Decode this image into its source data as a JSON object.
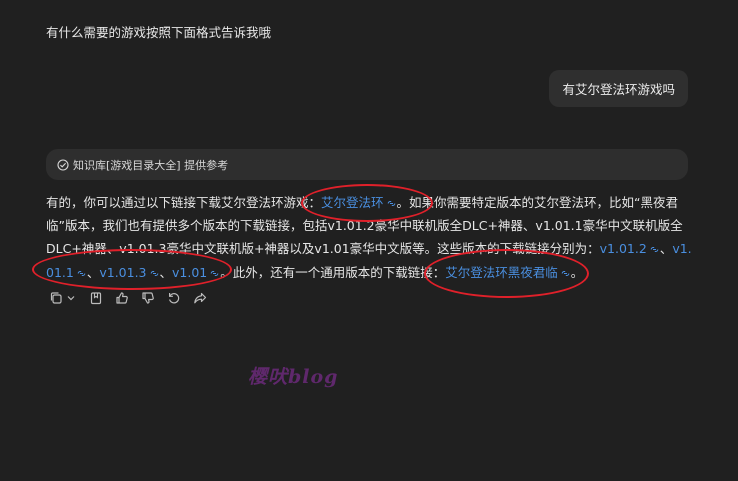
{
  "prompt": {
    "text": "有什么需要的游戏按照下面格式告诉我哦"
  },
  "user_message": {
    "text": "有艾尔登法环游戏吗"
  },
  "knowledge_bar": {
    "text": "知识库[游戏目录大全] 提供参考"
  },
  "answer": {
    "seg1": "有的，你可以通过以下链接下载艾尔登法环游戏：",
    "link1": "艾尔登法环",
    "seg2": "。如果你需要特定版本的艾尔登法环，比如“黑夜君临”版本，我们也有提供多个版本的下载链接，包括v1.01.2豪华中联机版全DLC+神器、v1.01.1豪华中文联机版全DLC+神器、v1.01.3豪华中文联机版+神器以及v1.01豪华中文版等。这些版本的下载链接分别为：",
    "link2": "v1.01.2",
    "sep1": "、",
    "link3": "v1.01.1",
    "sep2": "、",
    "link4": "v1.01.3",
    "sep3": "、",
    "link5": "v1.01",
    "seg3": "。此外，还有一个通用版本的下载链接：",
    "link6": "艾尔登法环黑夜君临",
    "seg4": "。"
  },
  "toolbar": {
    "icons": [
      "copy-icon",
      "chevron-down-icon",
      "bookmark-icon",
      "thumbs-up-icon",
      "thumbs-down-icon",
      "regenerate-icon",
      "share-icon"
    ]
  },
  "watermark": {
    "text": "樱吠blog"
  },
  "colors": {
    "background": "#202020",
    "link": "#4a8fe0",
    "annotation": "#e0202a",
    "bubble": "#2f2f2f"
  }
}
